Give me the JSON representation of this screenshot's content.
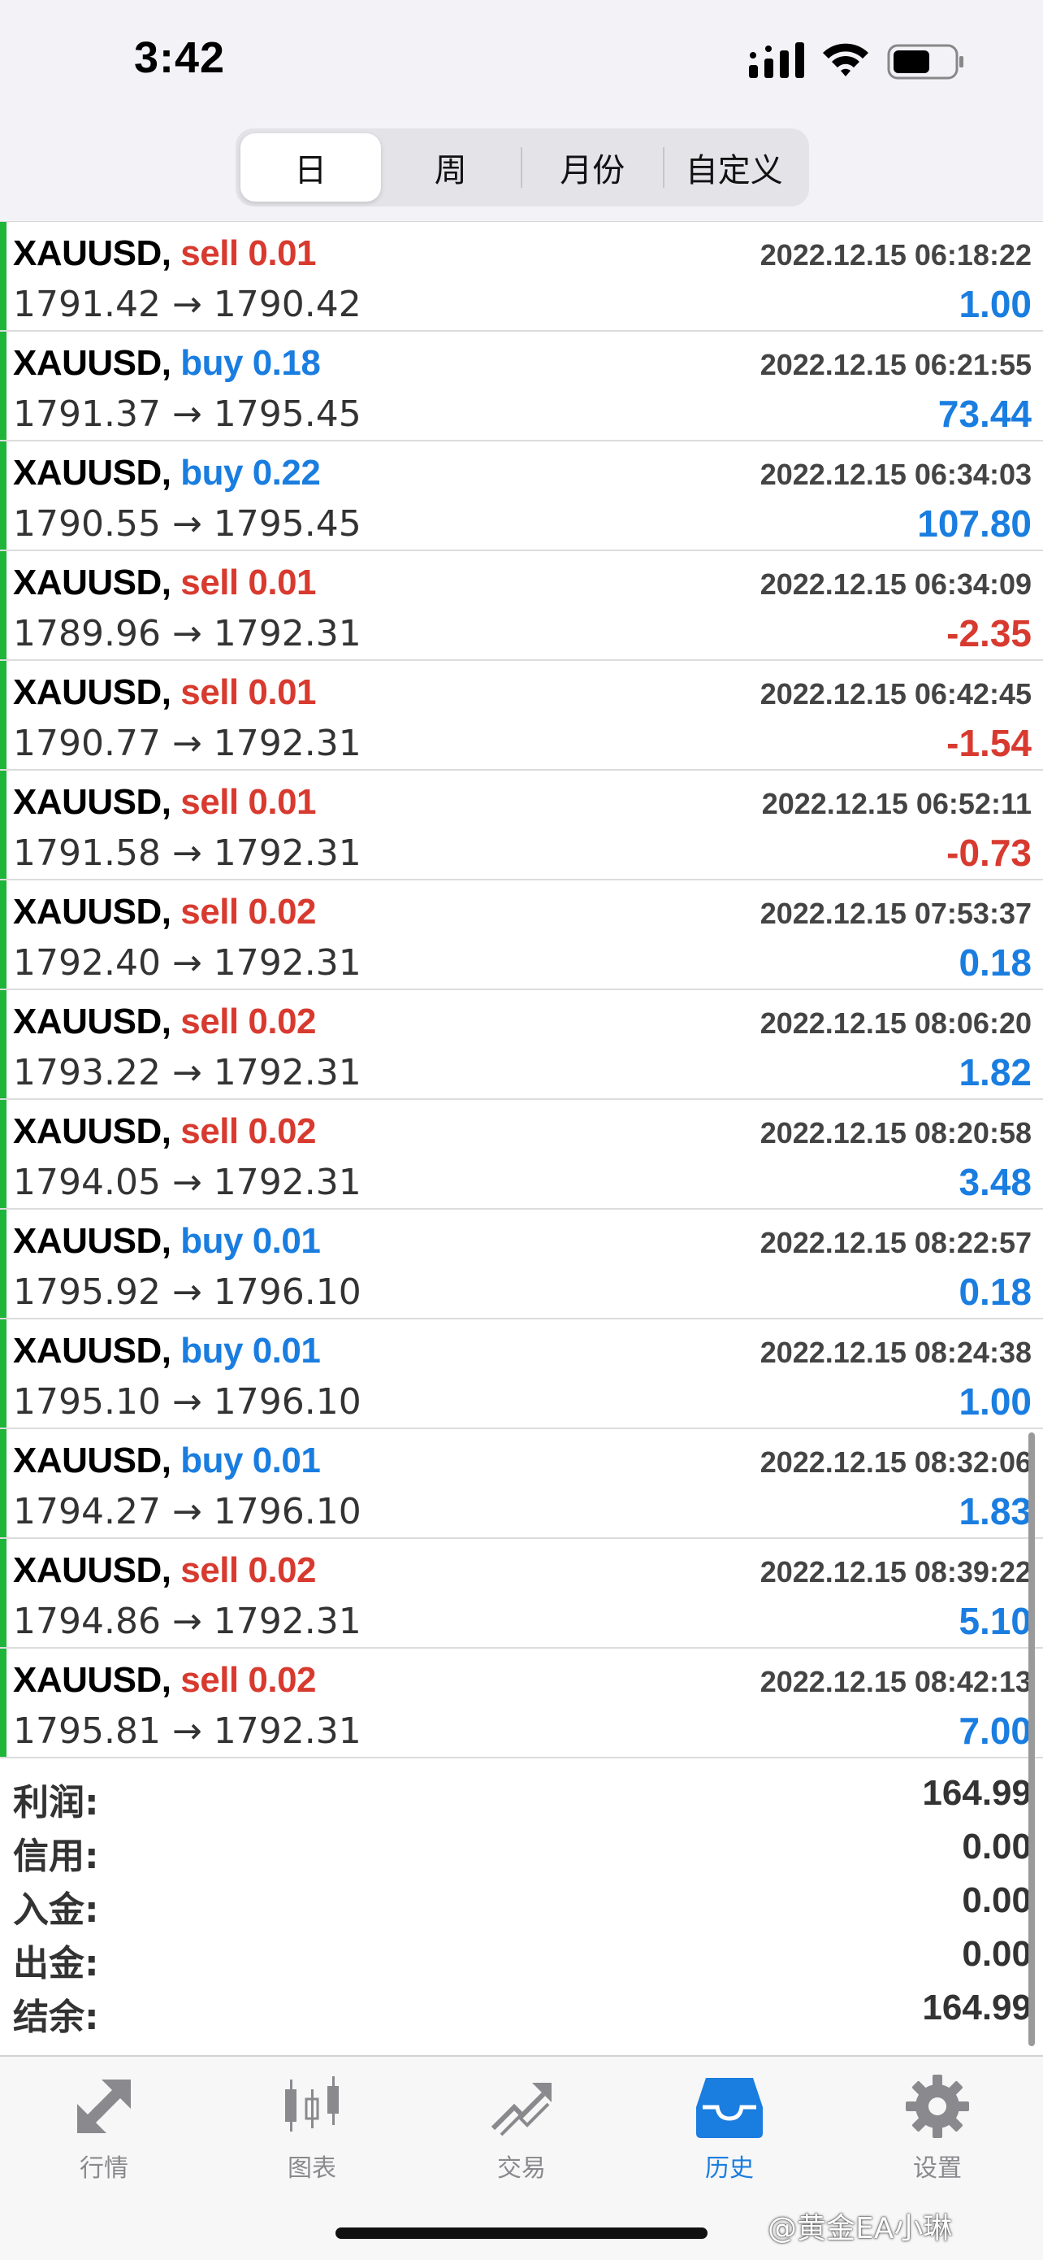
{
  "status_bar": {
    "time": "3:42"
  },
  "period_tabs": [
    {
      "label": "日",
      "active": true
    },
    {
      "label": "周",
      "active": false
    },
    {
      "label": "月份",
      "active": false
    },
    {
      "label": "自定义",
      "active": false
    }
  ],
  "history": [
    {
      "symbol": "XAUUSD,",
      "side": "sell",
      "side_label": "sell 0.01",
      "time": "2022.12.15 06:18:22",
      "prices": "1791.42 → 1790.42",
      "profit": "1.00",
      "profit_sign": "pos"
    },
    {
      "symbol": "XAUUSD,",
      "side": "buy",
      "side_label": "buy 0.18",
      "time": "2022.12.15 06:21:55",
      "prices": "1791.37 → 1795.45",
      "profit": "73.44",
      "profit_sign": "pos"
    },
    {
      "symbol": "XAUUSD,",
      "side": "buy",
      "side_label": "buy 0.22",
      "time": "2022.12.15 06:34:03",
      "prices": "1790.55 → 1795.45",
      "profit": "107.80",
      "profit_sign": "pos"
    },
    {
      "symbol": "XAUUSD,",
      "side": "sell",
      "side_label": "sell 0.01",
      "time": "2022.12.15 06:34:09",
      "prices": "1789.96 → 1792.31",
      "profit": "-2.35",
      "profit_sign": "neg"
    },
    {
      "symbol": "XAUUSD,",
      "side": "sell",
      "side_label": "sell 0.01",
      "time": "2022.12.15 06:42:45",
      "prices": "1790.77 → 1792.31",
      "profit": "-1.54",
      "profit_sign": "neg"
    },
    {
      "symbol": "XAUUSD,",
      "side": "sell",
      "side_label": "sell 0.01",
      "time": "2022.12.15 06:52:11",
      "prices": "1791.58 → 1792.31",
      "profit": "-0.73",
      "profit_sign": "neg"
    },
    {
      "symbol": "XAUUSD,",
      "side": "sell",
      "side_label": "sell 0.02",
      "time": "2022.12.15 07:53:37",
      "prices": "1792.40 → 1792.31",
      "profit": "0.18",
      "profit_sign": "pos"
    },
    {
      "symbol": "XAUUSD,",
      "side": "sell",
      "side_label": "sell 0.02",
      "time": "2022.12.15 08:06:20",
      "prices": "1793.22 → 1792.31",
      "profit": "1.82",
      "profit_sign": "pos"
    },
    {
      "symbol": "XAUUSD,",
      "side": "sell",
      "side_label": "sell 0.02",
      "time": "2022.12.15 08:20:58",
      "prices": "1794.05 → 1792.31",
      "profit": "3.48",
      "profit_sign": "pos"
    },
    {
      "symbol": "XAUUSD,",
      "side": "buy",
      "side_label": "buy 0.01",
      "time": "2022.12.15 08:22:57",
      "prices": "1795.92 → 1796.10",
      "profit": "0.18",
      "profit_sign": "pos"
    },
    {
      "symbol": "XAUUSD,",
      "side": "buy",
      "side_label": "buy 0.01",
      "time": "2022.12.15 08:24:38",
      "prices": "1795.10 → 1796.10",
      "profit": "1.00",
      "profit_sign": "pos"
    },
    {
      "symbol": "XAUUSD,",
      "side": "buy",
      "side_label": "buy 0.01",
      "time": "2022.12.15 08:32:06",
      "prices": "1794.27 → 1796.10",
      "profit": "1.83",
      "profit_sign": "pos"
    },
    {
      "symbol": "XAUUSD,",
      "side": "sell",
      "side_label": "sell 0.02",
      "time": "2022.12.15 08:39:22",
      "prices": "1794.86 → 1792.31",
      "profit": "5.10",
      "profit_sign": "pos"
    },
    {
      "symbol": "XAUUSD,",
      "side": "sell",
      "side_label": "sell 0.02",
      "time": "2022.12.15 08:42:13",
      "prices": "1795.81 → 1792.31",
      "profit": "7.00",
      "profit_sign": "pos"
    }
  ],
  "summary": [
    {
      "label": "利润:",
      "value": "164.99"
    },
    {
      "label": "信用:",
      "value": "0.00"
    },
    {
      "label": "入金:",
      "value": "0.00"
    },
    {
      "label": "出金:",
      "value": "0.00"
    },
    {
      "label": "结余:",
      "value": "164.99"
    }
  ],
  "tab_bar": [
    {
      "label": "行情",
      "icon": "quotes-arrows-icon",
      "active": false
    },
    {
      "label": "图表",
      "icon": "candlestick-chart-icon",
      "active": false
    },
    {
      "label": "交易",
      "icon": "trade-trend-icon",
      "active": false
    },
    {
      "label": "历史",
      "icon": "history-inbox-icon",
      "active": true
    },
    {
      "label": "设置",
      "icon": "gear-icon",
      "active": false
    }
  ],
  "watermark": "@黄金EA小琳",
  "colors": {
    "buy": "#1a7de0",
    "sell": "#d83a2f",
    "profit_bar": "#1fb53b",
    "active_tab": "#1a7de0"
  }
}
